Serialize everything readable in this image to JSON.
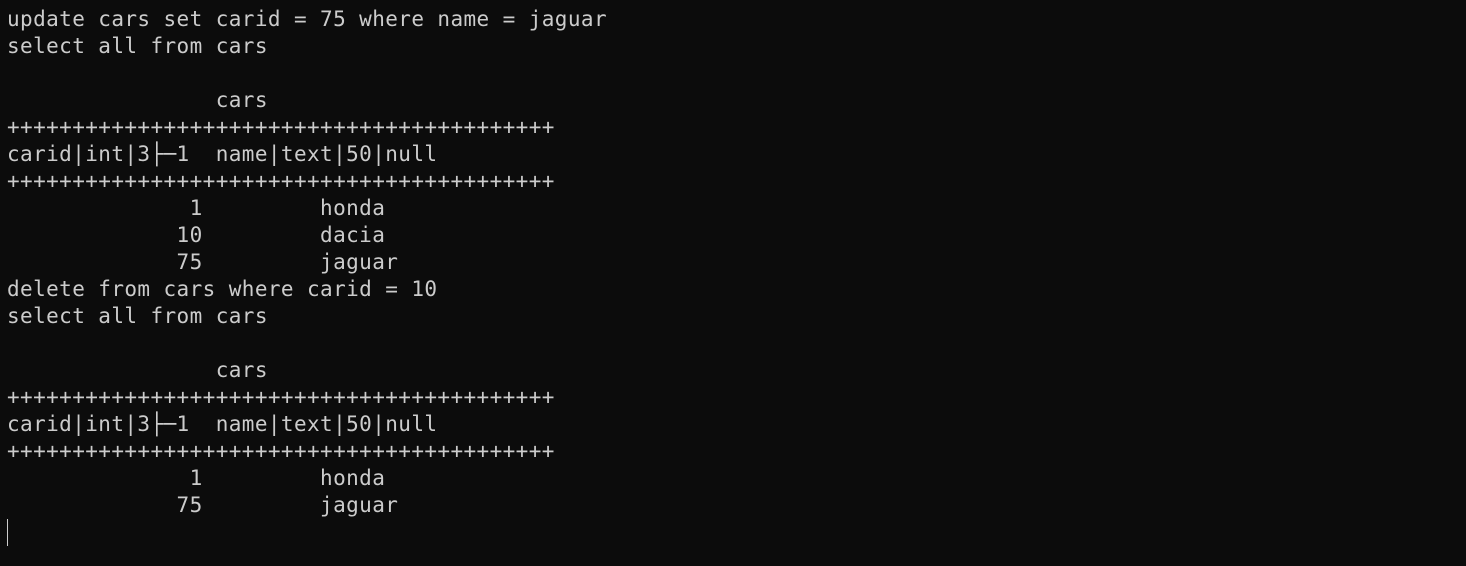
{
  "terminal": {
    "lines": [
      "update cars set carid = 75 where name = jaguar",
      "select all from cars",
      "",
      "                cars",
      "++++++++++++++++++++++++++++++++++++++++++",
      "carid|int|3├─1  name|text|50|null",
      "++++++++++++++++++++++++++++++++++++++++++",
      "              1         honda",
      "             10         dacia",
      "             75         jaguar",
      "delete from cars where carid = 10",
      "select all from cars",
      "",
      "                cars",
      "++++++++++++++++++++++++++++++++++++++++++",
      "carid|int|3├─1  name|text|50|null",
      "++++++++++++++++++++++++++++++++++++++++++",
      "              1         honda",
      "             75         jaguar"
    ]
  }
}
